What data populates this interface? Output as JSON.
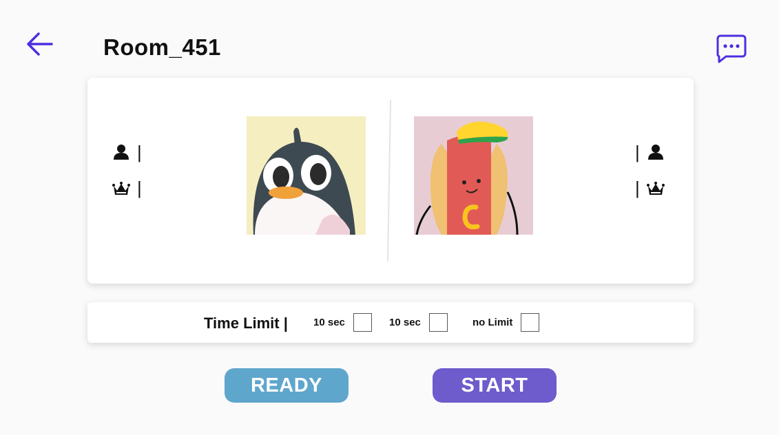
{
  "header": {
    "title": "Room_451",
    "back_icon": "arrow-left-icon",
    "chat_icon": "chat-bubble-icon",
    "accent_color": "#4b2fe0"
  },
  "players": {
    "left": {
      "avatar": "penguin",
      "name": "",
      "wins": ""
    },
    "right": {
      "avatar": "hotdog",
      "name": "",
      "wins": ""
    },
    "separator": "|",
    "user_icon": "user-icon",
    "crown_icon": "crown-icon"
  },
  "time_limit": {
    "label": "Time Limit |",
    "options": [
      {
        "label": "10 sec",
        "checked": false
      },
      {
        "label": "10 sec",
        "checked": false
      },
      {
        "label": "no Limit",
        "checked": false
      }
    ]
  },
  "buttons": {
    "ready": "READY",
    "start": "START",
    "ready_color": "#5fa6cc",
    "start_color": "#6e5bcc"
  }
}
